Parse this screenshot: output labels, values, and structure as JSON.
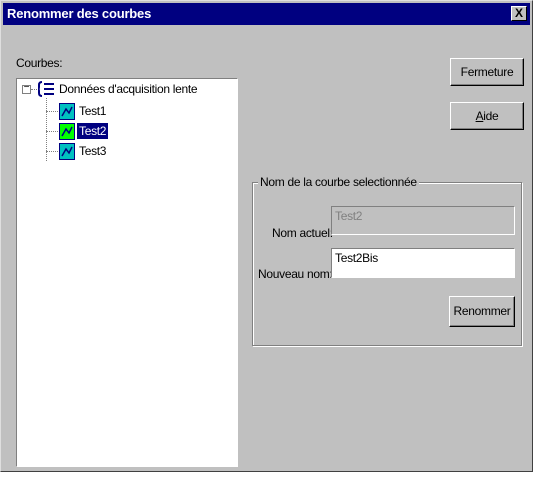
{
  "window": {
    "title": "Renommer des courbes",
    "close_glyph": "X"
  },
  "tree": {
    "label": "Courbes:",
    "expander_glyph": "−",
    "root": {
      "label": "Données d'acquisition lente",
      "icon": "data-group-icon"
    },
    "items": [
      {
        "label": "Test1",
        "icon": "curve-icon",
        "selected": false
      },
      {
        "label": "Test2",
        "icon": "curve-icon",
        "selected": true
      },
      {
        "label": "Test3",
        "icon": "curve-icon",
        "selected": false
      }
    ]
  },
  "buttons": {
    "close_label": "Fermeture",
    "help_label": "Aide",
    "help_mnemonic": "A",
    "help_rest": "ide",
    "rename_label": "Renommer"
  },
  "group": {
    "title": "Nom de la courbe selectionnée",
    "current_name_label": "Nom actuel:",
    "current_name_value": "Test2",
    "new_name_label": "Nouveau nom:",
    "new_name_value": "Test2Bis"
  },
  "colors": {
    "titlebar": "#000080",
    "face": "#c0c0c0",
    "selection": "#000080",
    "curve_icon_bg": "#00c0c0",
    "curve_icon_selected_bg": "#00ff00"
  }
}
